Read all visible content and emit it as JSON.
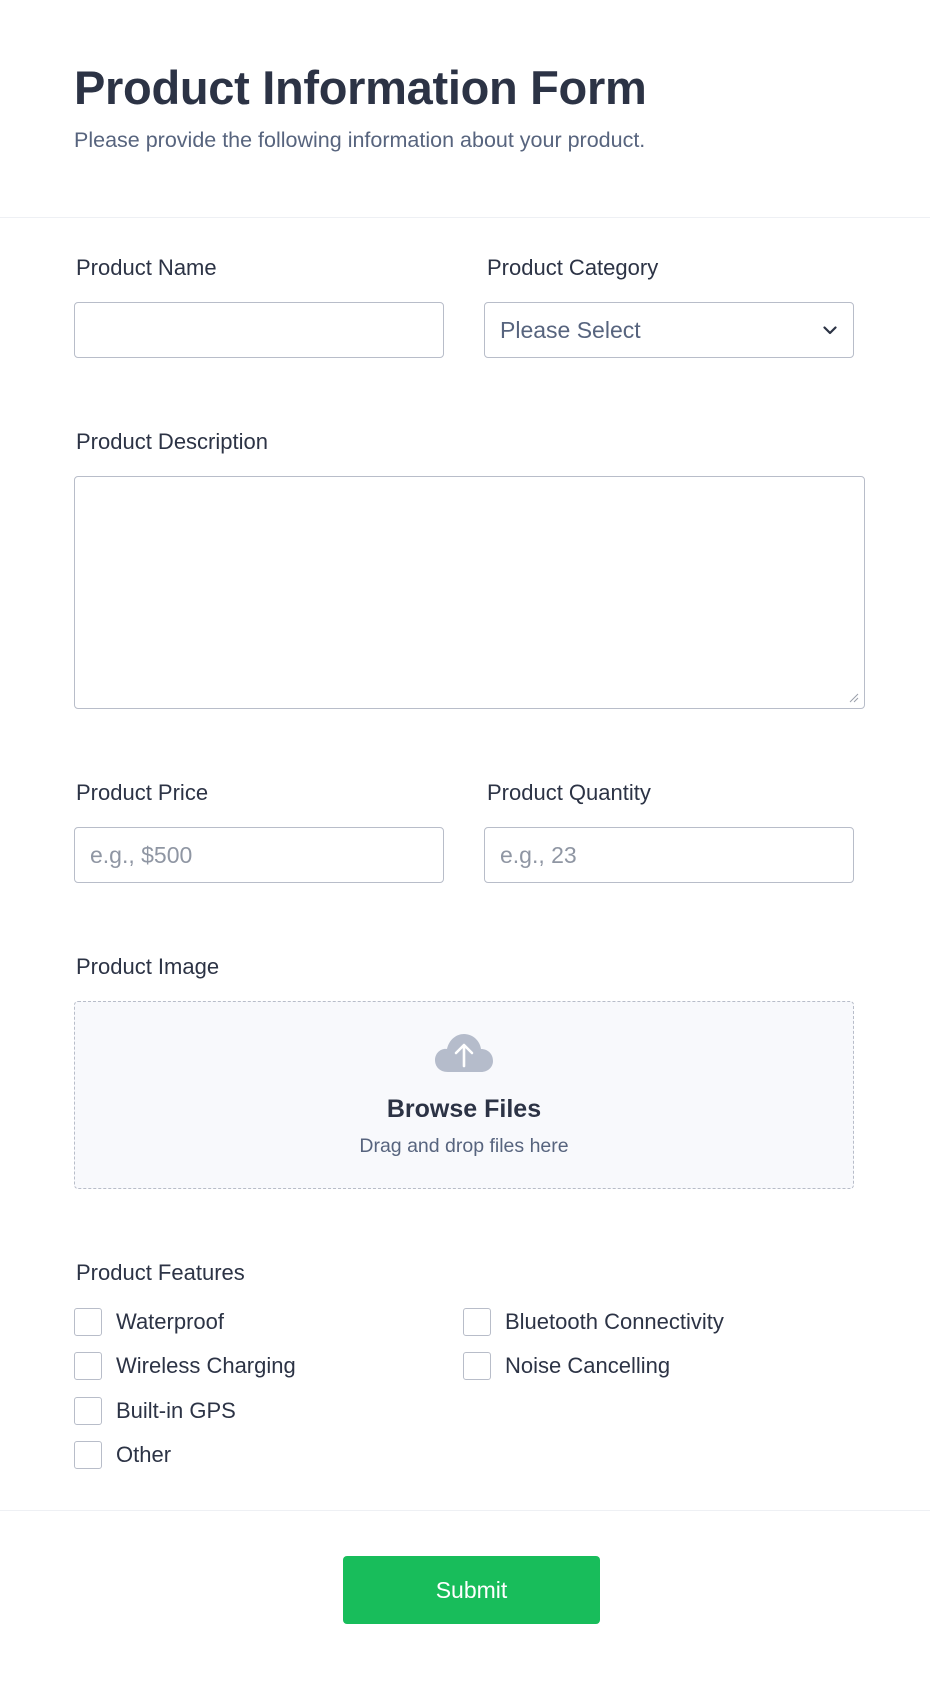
{
  "header": {
    "title": "Product Information Form",
    "subtitle": "Please provide the following information about your product."
  },
  "fields": {
    "product_name": {
      "label": "Product Name",
      "value": "",
      "placeholder": ""
    },
    "product_category": {
      "label": "Product Category",
      "selected": "Please Select"
    },
    "product_description": {
      "label": "Product Description",
      "value": ""
    },
    "product_price": {
      "label": "Product Price",
      "value": "",
      "placeholder": "e.g., $500"
    },
    "product_quantity": {
      "label": "Product Quantity",
      "value": "",
      "placeholder": "e.g., 23"
    },
    "product_image": {
      "label": "Product Image",
      "browse_label": "Browse Files",
      "hint": "Drag and drop files here"
    }
  },
  "features": {
    "label": "Product Features",
    "options": [
      {
        "label": "Waterproof",
        "checked": false
      },
      {
        "label": "Bluetooth Connectivity",
        "checked": false
      },
      {
        "label": "Wireless Charging",
        "checked": false
      },
      {
        "label": "Noise Cancelling",
        "checked": false
      },
      {
        "label": "Built-in GPS",
        "checked": false
      },
      {
        "label": "Other",
        "checked": false
      }
    ]
  },
  "submit": {
    "label": "Submit"
  },
  "colors": {
    "primary_text": "#2c3345",
    "secondary_text": "#57647e",
    "submit_button": "#18bd5b",
    "border": "#b8bdc9",
    "dropzone_bg": "#f8f9fc"
  },
  "icons": {
    "select": "chevron-down-icon",
    "upload": "cloud-upload-icon"
  }
}
